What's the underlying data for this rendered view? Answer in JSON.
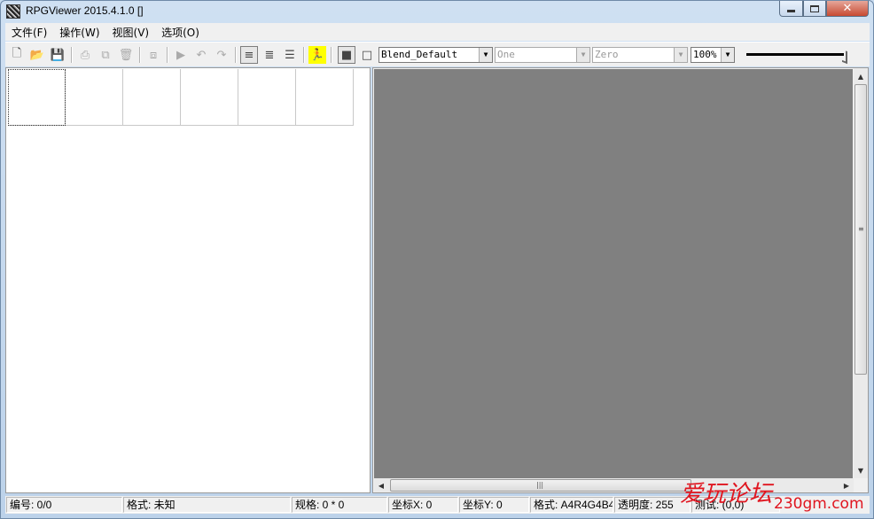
{
  "window": {
    "title": "RPGViewer 2015.4.1.0 []",
    "close_glyph": "✕"
  },
  "menu": [
    "文件(F)",
    "操作(W)",
    "视图(V)",
    "选项(O)"
  ],
  "toolbar": {
    "blend_mode": "Blend_Default",
    "source_mode": "One",
    "dest_mode": "Zero",
    "zoom": "100%"
  },
  "icons": {
    "new": "🗋",
    "open": "📂",
    "save": "💾",
    "print": "⎙",
    "copy": "⧉",
    "delete": "🗑",
    "layers": "⧈",
    "play": "▶",
    "undo": "↶",
    "redo": "↷",
    "align_left": "≡",
    "align_center": "≣",
    "list": "☰",
    "runner": "🏃",
    "fill": "■",
    "frame": "□"
  },
  "status": {
    "index": "编号: 0/0",
    "format": "格式: 未知",
    "size": "规格: 0 * 0",
    "coord_x": "坐标X: 0",
    "coord_y": "坐标Y: 0",
    "pixel_format": "格式: A4R4G4B4",
    "opacity": "透明度: 255",
    "debug": "测试: (0,0)"
  },
  "watermark": {
    "text": "爱玩论坛",
    "url": "230gm.com"
  },
  "colors": {
    "canvas_bg": "#808080",
    "watermark": "#e0151f"
  }
}
